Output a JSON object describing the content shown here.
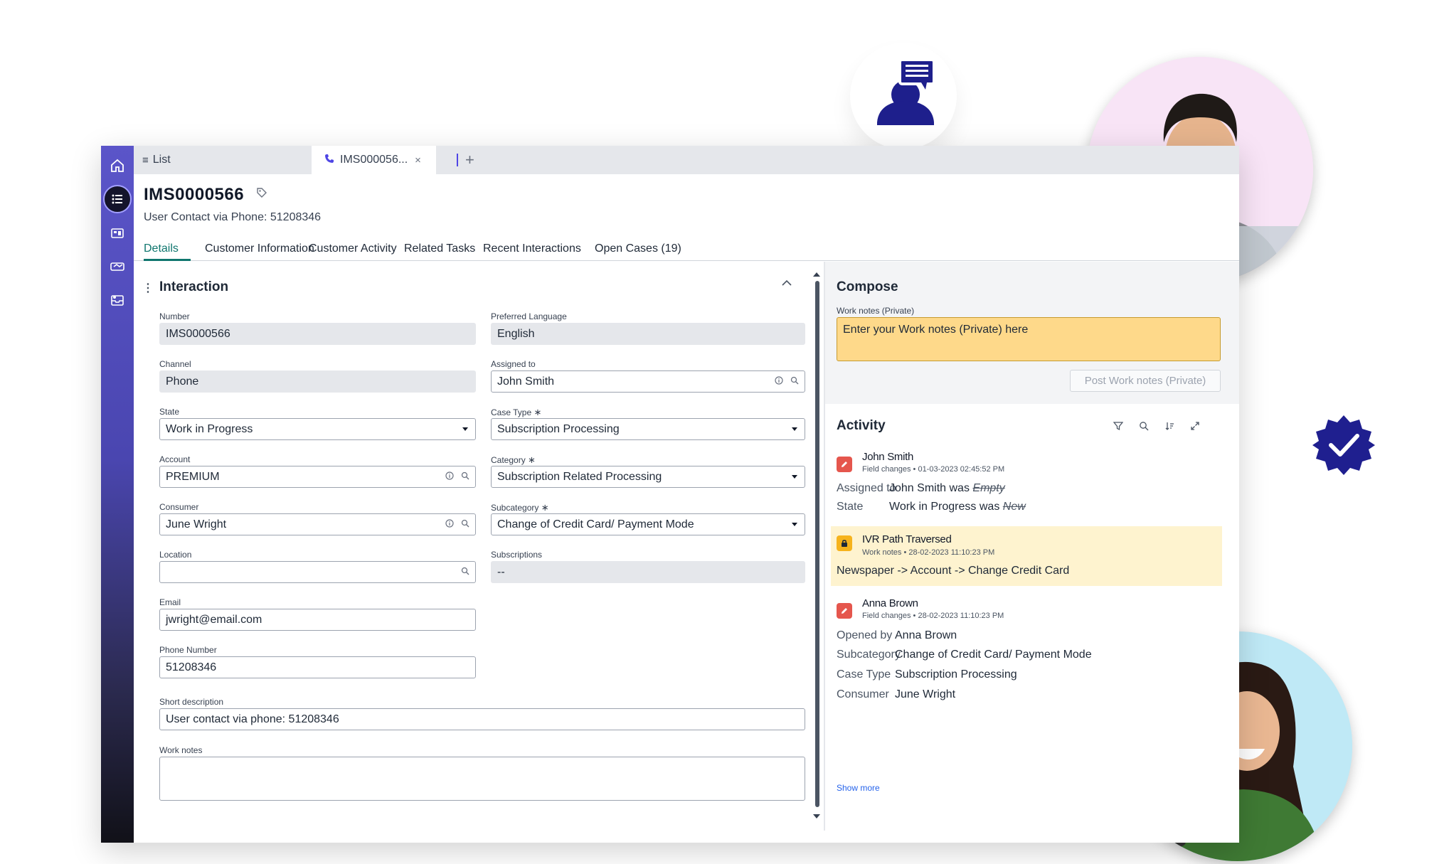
{
  "tabs": {
    "list_label": "List",
    "active_label": "IMS000056...",
    "close_glyph": "×",
    "add_glyph": "+"
  },
  "record": {
    "number": "IMS0000566",
    "subtitle": "User Contact via Phone: 51208346"
  },
  "subtabs": [
    "Details",
    "Customer Information",
    "Customer Activity",
    "Related Tasks",
    "Recent Interactions",
    "Open Cases (19)"
  ],
  "section": {
    "title": "Interaction"
  },
  "form": {
    "number": {
      "label": "Number",
      "value": "IMS0000566"
    },
    "preferred_language": {
      "label": "Preferred Language",
      "value": "English"
    },
    "channel": {
      "label": "Channel",
      "value": "Phone"
    },
    "assigned_to": {
      "label": "Assigned to",
      "value": "John Smith"
    },
    "state": {
      "label": "State",
      "value": "Work in Progress"
    },
    "case_type": {
      "label": "Case Type",
      "value": "Subscription Processing"
    },
    "account": {
      "label": "Account",
      "value": "PREMIUM"
    },
    "category": {
      "label": "Category",
      "value": "Subscription Related Processing"
    },
    "consumer": {
      "label": "Consumer",
      "value": "June Wright"
    },
    "subcategory": {
      "label": "Subcategory",
      "value": "Change of Credit Card/ Payment Mode"
    },
    "location": {
      "label": "Location",
      "value": ""
    },
    "subscriptions": {
      "label": "Subscriptions",
      "value": "--"
    },
    "email": {
      "label": "Email",
      "value": "jwright@email.com"
    },
    "phone_number": {
      "label": "Phone Number",
      "value": "51208346"
    },
    "short_description": {
      "label": "Short description",
      "value": "User contact via phone: 51208346"
    },
    "work_notes": {
      "label": "Work notes",
      "value": ""
    },
    "required_glyph": "∗"
  },
  "compose": {
    "title": "Compose",
    "field_label": "Work notes (Private)",
    "placeholder": "Enter your Work notes (Private) here",
    "post_label": "Post Work notes (Private)"
  },
  "activity": {
    "title": "Activity",
    "entries": [
      {
        "author": "John Smith",
        "meta": "Field changes • 01-03-2023 02:45:52 PM",
        "changes": [
          {
            "key": "Assigned to",
            "value": "John Smith",
            "connector": "was",
            "old": "Empty"
          },
          {
            "key": "State",
            "value": "Work in Progress",
            "connector": "was",
            "old": "New"
          }
        ]
      },
      {
        "author": "IVR Path Traversed",
        "meta": "Work notes • 28-02-2023 11:10:23 PM",
        "note": "Newspaper -> Account -> Change Credit Card"
      },
      {
        "author": "Anna Brown",
        "meta": "Field changes • 28-02-2023 11:10:23 PM",
        "changes": [
          {
            "key": "Opened by",
            "value": "Anna Brown"
          },
          {
            "key": "Subcategory",
            "value": "Change of Credit Card/ Payment Mode"
          },
          {
            "key": "Case Type",
            "value": "Subscription Processing"
          },
          {
            "key": "Consumer",
            "value": "June Wright"
          }
        ]
      }
    ],
    "show_more": "Show more"
  },
  "icons": {
    "rail": [
      "home-icon",
      "list-icon",
      "dashboard-icon",
      "handshake-icon",
      "inbox-icon"
    ],
    "field": [
      "info-icon",
      "search-icon",
      "dropdown-caret-icon"
    ],
    "activity_tools": [
      "filter-icon",
      "search-icon",
      "sort-icon",
      "expand-icon"
    ],
    "decor": [
      "agent-chat-icon",
      "verified-badge-icon"
    ]
  },
  "colors": {
    "accent_teal": "#0f766e",
    "rail_top": "#5b55c9",
    "rail_bottom": "#111118",
    "compose_input": "#fed98a",
    "ivr_highlight": "#fef3cf",
    "badge_navy": "#1f1f8f",
    "agent_icon": "#1e1f8c",
    "edit_red": "#e5564d",
    "lock_yellow": "#f6b31c"
  }
}
